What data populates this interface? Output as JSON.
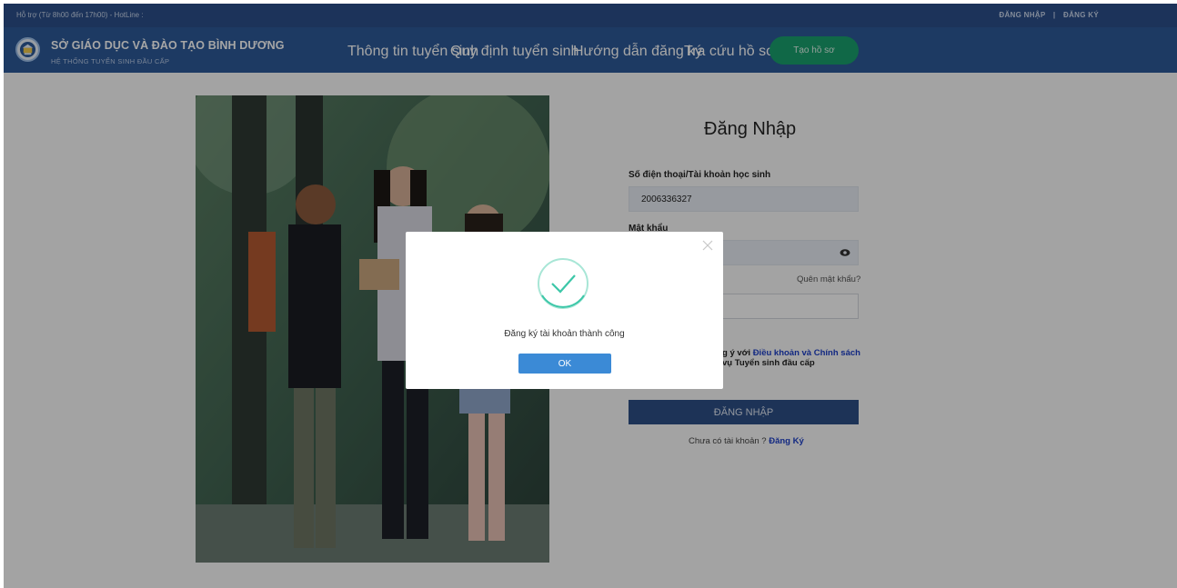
{
  "topbar": {
    "support": "Hỗ trợ (Từ 8h00 đến 17h00) - HotLine :",
    "login": "ĐĂNG NHẬP",
    "separator": "|",
    "register": "ĐĂNG KÝ"
  },
  "header": {
    "title": "SỞ GIÁO DỤC VÀ ĐÀO TẠO BÌNH DƯƠNG",
    "subtitle": "HỆ THỐNG TUYỂN SINH ĐẦU CẤP",
    "nav": [
      {
        "label": "Thông tin tuyển sinh"
      },
      {
        "label": "Quy định tuyển sinh"
      },
      {
        "label": "Hướng dẫn đăng ký"
      },
      {
        "label": "Tra cứu hồ sơ"
      }
    ],
    "create_button": "Tạo hồ sơ"
  },
  "login": {
    "title": "Đăng Nhập",
    "account_label": "Số điện thoại/Tài khoản học sinh",
    "account_value": "2006336327",
    "password_label": "Mật khẩu",
    "forgot": "Quên mật khẩu?",
    "terms_prefix": "g ý với ",
    "terms_link": "Điều khoản và Chính sách",
    "terms_line2": "vụ Tuyển sinh đầu cấp",
    "submit": "ĐĂNG NHẬP",
    "no_account": "Chưa có tài khoản ? ",
    "register_link": "Đăng Ký"
  },
  "modal": {
    "message": "Đăng ký tài khoản thành công",
    "ok": "OK"
  },
  "colors": {
    "topbar": "#2b4f8a",
    "header": "#2d5998",
    "create_button": "#1aa06d",
    "login_button": "#2d4f86",
    "ok_button": "#3b8ad6",
    "success_check": "#3cc7a8",
    "link": "#1e40c8"
  },
  "icons": {
    "logo": "school-seal-icon",
    "eye": "eye-icon",
    "close": "close-icon",
    "success": "check-circle-icon"
  }
}
